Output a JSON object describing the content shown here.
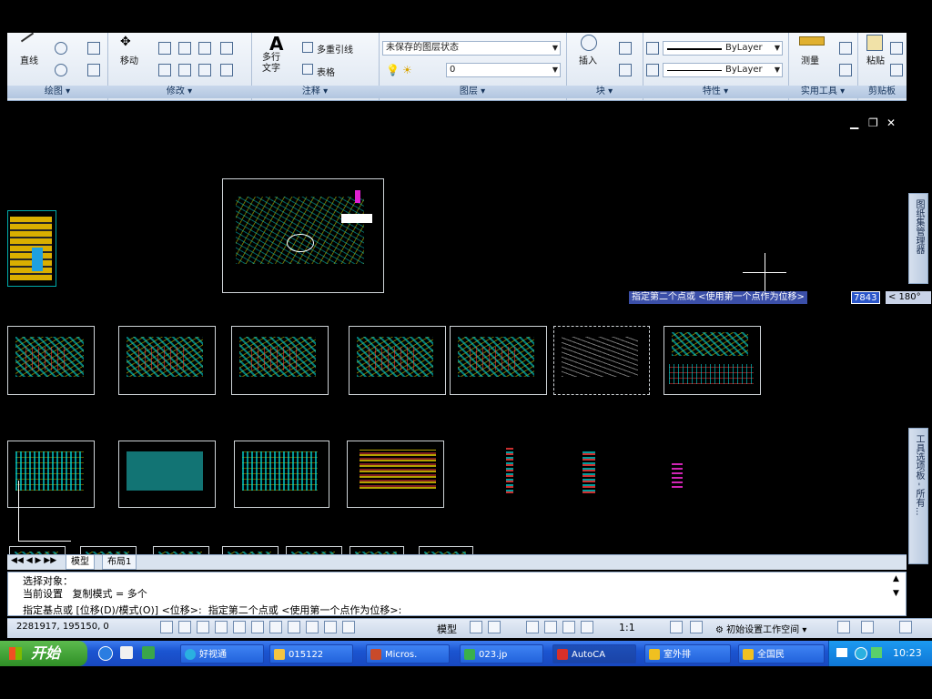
{
  "ribbon": {
    "panels": [
      {
        "title": "绘图",
        "buttons": [
          "直线"
        ]
      },
      {
        "title": "修改",
        "buttons": [
          "移动"
        ]
      },
      {
        "title": "注释",
        "buttons": [
          "多行文字",
          "多重引线",
          "表格"
        ]
      },
      {
        "title": "图层",
        "layer_state": "未保存的图层状态",
        "current_layer": "0"
      },
      {
        "title": "块",
        "buttons": [
          "插入"
        ]
      },
      {
        "title": "特性",
        "color": "ByLayer",
        "linetype": "ByLayer"
      },
      {
        "title": "实用工具",
        "buttons": [
          "测量"
        ]
      },
      {
        "title": "剪贴板",
        "buttons": [
          "粘贴"
        ]
      }
    ]
  },
  "palettes": [
    "图纸集管理器",
    "工具选项板 - 所有..."
  ],
  "drawing": {
    "dyn_prompt": "指定第二个点或 <使用第一个点作为位移>",
    "dyn_value": "7843",
    "dyn_angle": "< 180°"
  },
  "tabs": [
    "模型",
    "布局1"
  ],
  "command_lines": [
    "选择对象：",
    "当前设置   复制模式 = 多个",
    "指定基点或 [位移(D)/模式(O)] <位移>:  指定第二个点或 <使用第一个点作为位移>:"
  ],
  "status": {
    "coordinates": "2281917, 195150, 0",
    "model_label": "模型",
    "scale": "1:1",
    "workspace": "初始设置工作空间"
  },
  "taskbar": {
    "start": "开始",
    "tasks": [
      "好视通",
      "015122",
      "Micros.",
      "023.jp",
      "AutoCA",
      "室外排",
      "全国民"
    ],
    "clock": "10:23"
  },
  "colors": {
    "ribbon_bg": "#dde6f1",
    "canvas_bg": "#000000",
    "taskbar": "#1b55d1",
    "start_button": "#2f8f26"
  }
}
